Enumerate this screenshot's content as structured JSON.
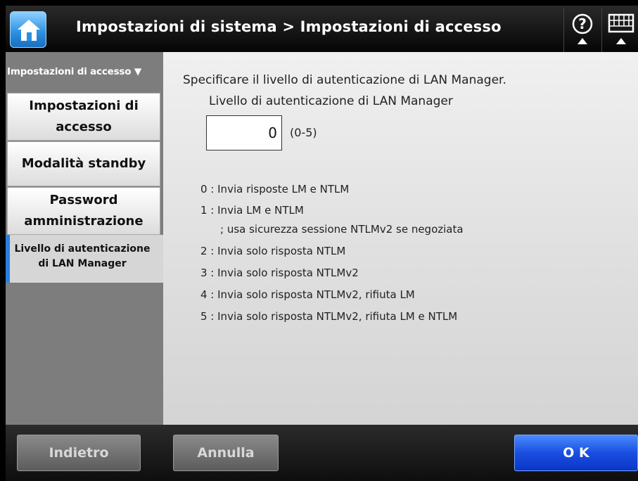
{
  "header": {
    "title": "Impostazioni di sistema > Impostazioni di accesso",
    "home_icon": "home-icon",
    "help_icon": "help-icon",
    "keyboard_icon": "keyboard-icon"
  },
  "sidebar": {
    "header": "Impostazioni di accesso ▼",
    "items": [
      {
        "line1": "Impostazioni di",
        "line2": "accesso"
      },
      {
        "line1": "Modalità standby",
        "line2": ""
      },
      {
        "line1": "Password",
        "line2": "amministrazione"
      }
    ],
    "selected": {
      "line1": "Livello di autenticazione",
      "line2": "di LAN Manager"
    }
  },
  "main": {
    "intro": "Specificare il livello di autenticazione di LAN Manager.",
    "field_label": "Livello di autenticazione di LAN Manager",
    "value": "0",
    "range": "(0-5)",
    "options": [
      "0 : Invia risposte LM e NTLM",
      "1 : Invia LM e NTLM",
      "; usa sicurezza sessione NTLMv2 se negoziata",
      "2 : Invia solo risposta NTLM",
      "3 : Invia solo risposta NTLMv2",
      "4 : Invia solo risposta NTLMv2, rifiuta LM",
      "5 : Invia solo risposta NTLMv2, rifiuta LM e NTLM"
    ]
  },
  "footer": {
    "back": "Indietro",
    "cancel": "Annulla",
    "ok": "O K"
  },
  "colors": {
    "accent": "#2a7fe0",
    "ok_button": "#1a4fe0"
  }
}
